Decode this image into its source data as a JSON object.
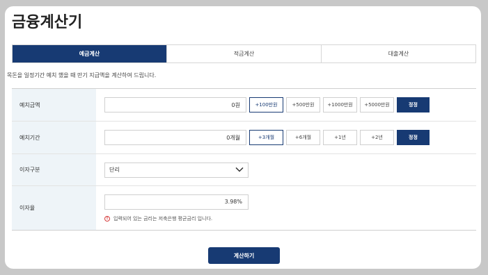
{
  "page": {
    "title": "금융계산기",
    "description": "목돈을 일정기간 예치 했을 때 만기 지급액을 계산하여 드립니다."
  },
  "tabs": [
    {
      "label": "예금계산",
      "active": true
    },
    {
      "label": "적금계산",
      "active": false
    },
    {
      "label": "대출계산",
      "active": false
    }
  ],
  "form": {
    "deposit_amount": {
      "label": "예치금액",
      "value": "0원",
      "buttons": [
        "+100만원",
        "+500만원",
        "+1000만원",
        "+5000만원"
      ],
      "selected": "+100만원",
      "reset_label": "정정"
    },
    "deposit_period": {
      "label": "예치기간",
      "value": "0개월",
      "buttons": [
        "+3개월",
        "+6개월",
        "+1년",
        "+2년"
      ],
      "selected": "+3개월",
      "reset_label": "정정"
    },
    "interest_type": {
      "label": "이자구분",
      "value": "단리",
      "chevron_icon": "chevron-down-icon"
    },
    "interest_rate": {
      "label": "이자율",
      "value": "3.98%",
      "notice_icon": "alert-circle-icon",
      "notice": "입력되어 있는 금리는 저축은행 평균금리 입니다."
    }
  },
  "submit_label": "계산하기",
  "colors": {
    "primary": "#173a73",
    "label_bg": "#eef4f8",
    "page_bg": "#c8c8c8",
    "notice_red": "#d63b3b"
  }
}
